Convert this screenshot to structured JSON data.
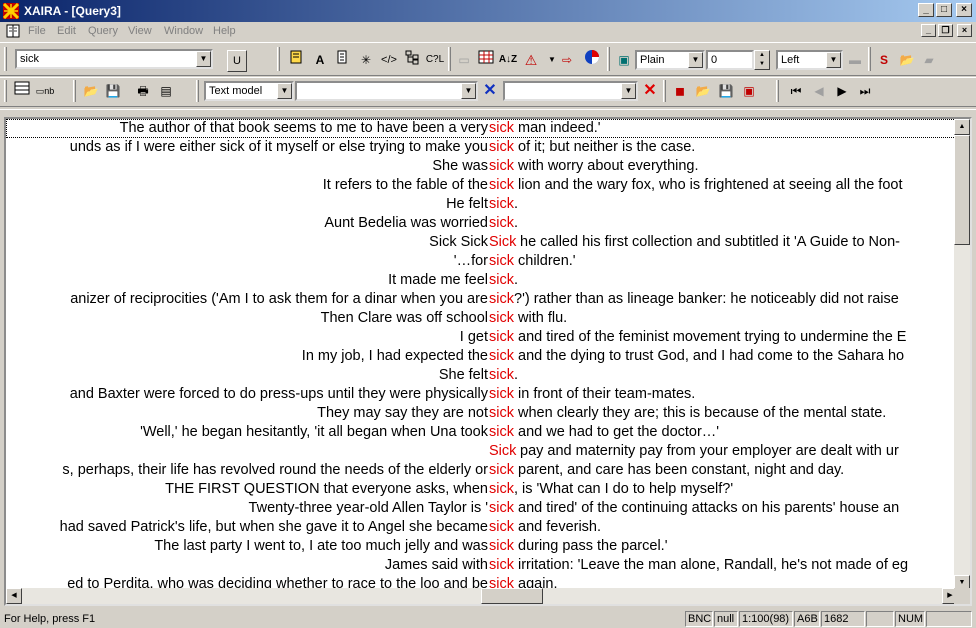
{
  "window": {
    "title": "XAIRA - [Query3]"
  },
  "menu": [
    "File",
    "Edit",
    "Query",
    "View",
    "Window",
    "Help"
  ],
  "toolbar": {
    "search_value": "sick",
    "u_label": "U",
    "style_value": "Plain",
    "size_value": "0",
    "align_value": "Left",
    "model_value": "Text model",
    "filter1_value": "",
    "filter2_value": ""
  },
  "concordance": [
    {
      "left": "The author of that book seems to me to have been a very",
      "kw": "sick",
      "right": "man indeed.'"
    },
    {
      "left": "unds as if I were either sick of it myself or else trying to make you",
      "kw": "sick",
      "right": "of it; but neither is the case."
    },
    {
      "left": "She was",
      "kw": "sick",
      "right": "with worry about everything."
    },
    {
      "left": "It refers to the fable of the",
      "kw": "sick",
      "right": "lion and the wary fox, who is frightened at seeing all the foot"
    },
    {
      "left": "He felt",
      "kw": "sick",
      "right": "."
    },
    {
      "left": "Aunt Bedelia was worried",
      "kw": "sick",
      "right": "."
    },
    {
      "left": "Sick Sick",
      "kw": "Sick",
      "right": "he called his first collection and subtitled it 'A Guide to Non-"
    },
    {
      "left": "'…for",
      "kw": "sick",
      "right": "children.'"
    },
    {
      "left": "It made me feel",
      "kw": "sick",
      "right": "."
    },
    {
      "left": "anizer of reciprocities ('Am I to ask them for a dinar when you are",
      "kw": "sick",
      "right": "?') rather than as lineage banker: he noticeably did not raise"
    },
    {
      "left": "Then Clare was off school",
      "kw": "sick",
      "right": "with flu."
    },
    {
      "left": "I get",
      "kw": "sick",
      "right": "and tired of the feminist movement trying to undermine the E"
    },
    {
      "left": "In my job, I had expected the",
      "kw": "sick",
      "right": "and the dying to trust God, and I had come to the Sahara ho"
    },
    {
      "left": "She felt",
      "kw": "sick",
      "right": "."
    },
    {
      "left": "and Baxter were forced to do press-ups until they were physically",
      "kw": "sick",
      "right": "in front of their team-mates."
    },
    {
      "left": "They may say they are not",
      "kw": "sick",
      "right": "when clearly they are; this is because of the mental state."
    },
    {
      "left": "'Well,' he began hesitantly, 'it all began when Una took",
      "kw": "sick",
      "right": "and we had to get the doctor…'"
    },
    {
      "left": "",
      "kw": "Sick",
      "right": "pay and maternity pay from your employer are dealt with ur"
    },
    {
      "left": "s, perhaps, their life has revolved round the needs of the elderly or",
      "kw": "sick",
      "right": "parent, and care has been constant, night and day."
    },
    {
      "left": "THE FIRST QUESTION that everyone asks, when",
      "kw": "sick",
      "right": ", is 'What can I do to help myself?'"
    },
    {
      "left": "Twenty-three year-old Allen Taylor is '",
      "kw": "sick",
      "right": "and tired' of the continuing attacks on his parents' house an"
    },
    {
      "left": "had saved Patrick's life, but when she gave it to Angel she became",
      "kw": "sick",
      "right": "and feverish."
    },
    {
      "left": "The last party I went to, I ate too much jelly and was",
      "kw": "sick",
      "right": "during pass the parcel.'"
    },
    {
      "left": "James said with",
      "kw": "sick",
      "right": "irritation: 'Leave the man alone, Randall, he's not made of eg"
    },
    {
      "left": "ed to Perdita, who was deciding whether to race to the loo and be",
      "kw": "sick",
      "right": "again."
    }
  ],
  "status": {
    "help": "For Help, press F1",
    "panels": [
      "BNC",
      "null",
      "1:100(98)",
      "A6B",
      "1682",
      "",
      "NUM",
      ""
    ]
  }
}
